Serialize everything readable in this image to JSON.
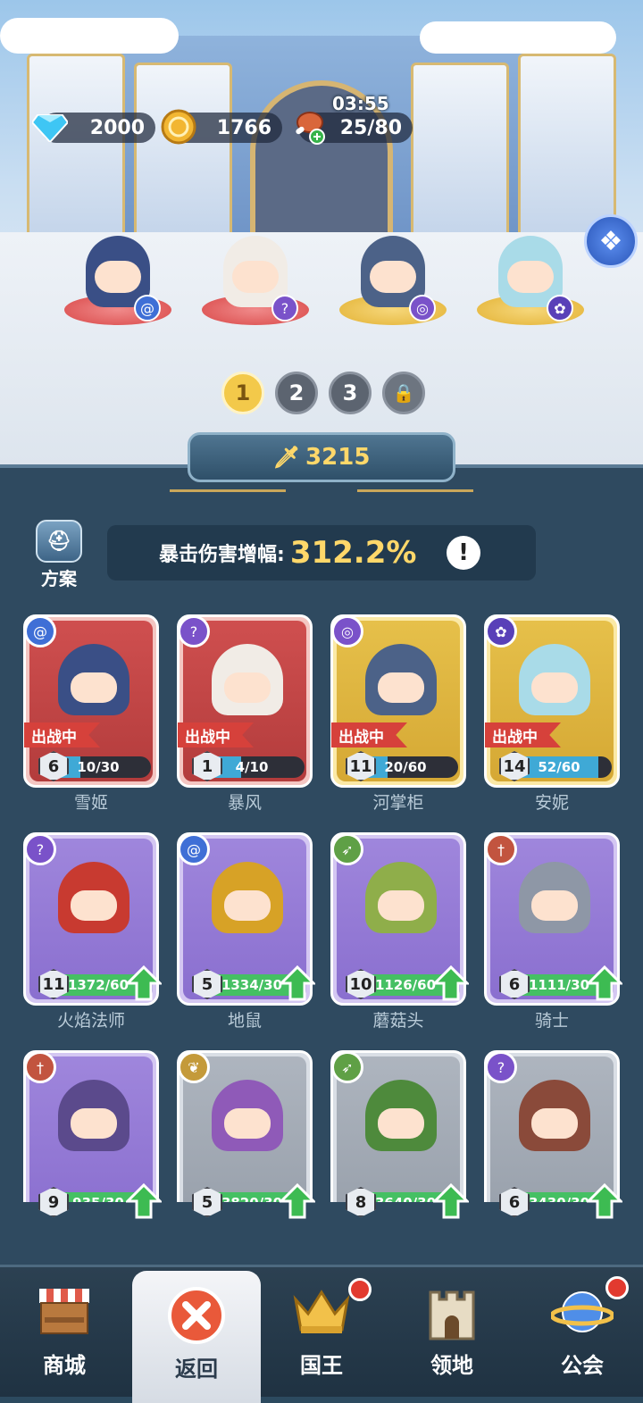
{
  "resources": {
    "gems": "2000",
    "gold": "1766",
    "stamina": "25/80",
    "stamina_timer": "03:55"
  },
  "heroes_on_field": [
    {
      "name": "雪姬",
      "ring": "red",
      "class_icon": "spiral-icon"
    },
    {
      "name": "暴风",
      "ring": "red",
      "class_icon": "wand-icon"
    },
    {
      "name": "河掌柜",
      "ring": "gold",
      "class_icon": "eye-icon"
    },
    {
      "name": "安妮",
      "ring": "gold",
      "class_icon": "paw-icon"
    }
  ],
  "teams": [
    "1",
    "2",
    "3"
  ],
  "power": "3215",
  "plan_label": "方案",
  "crit": {
    "label": "暴击伤害增幅:",
    "value": "312.2%",
    "info": "!"
  },
  "cards": [
    {
      "name": "雪姬",
      "rarity": "red",
      "class_icon": "spiral-icon",
      "status": "出战中",
      "level": "6",
      "progress": "10/30",
      "fill": 0.33,
      "upgrade": false,
      "color": "#3a4f86"
    },
    {
      "name": "暴风",
      "rarity": "red",
      "class_icon": "wand-icon",
      "status": "出战中",
      "level": "1",
      "progress": "4/10",
      "fill": 0.4,
      "upgrade": false,
      "color": "#f1ece6"
    },
    {
      "name": "河掌柜",
      "rarity": "gold",
      "class_icon": "eye-icon",
      "status": "出战中",
      "level": "11",
      "progress": "20/60",
      "fill": 0.33,
      "upgrade": false,
      "color": "#4c6288"
    },
    {
      "name": "安妮",
      "rarity": "gold",
      "class_icon": "paw-icon",
      "status": "出战中",
      "level": "14",
      "progress": "52/60",
      "fill": 0.87,
      "upgrade": false,
      "color": "#a9dbe8"
    },
    {
      "name": "火焰法师",
      "rarity": "purple",
      "class_icon": "wand-icon",
      "status": "",
      "level": "11",
      "progress": "1372/60",
      "fill": 1,
      "upgrade": true,
      "color": "#c83a30"
    },
    {
      "name": "地鼠",
      "rarity": "purple",
      "class_icon": "spiral-icon",
      "status": "",
      "level": "5",
      "progress": "1334/30",
      "fill": 1,
      "upgrade": true,
      "color": "#d7a226"
    },
    {
      "name": "蘑菇头",
      "rarity": "purple",
      "class_icon": "bow-icon",
      "status": "",
      "level": "10",
      "progress": "1126/60",
      "fill": 1,
      "upgrade": true,
      "color": "#8fae4a"
    },
    {
      "name": "骑士",
      "rarity": "purple",
      "class_icon": "sword-icon",
      "status": "",
      "level": "6",
      "progress": "1111/30",
      "fill": 1,
      "upgrade": true,
      "color": "#8e97a6"
    },
    {
      "name": "",
      "rarity": "purple",
      "class_icon": "sword-icon",
      "status": "",
      "level": "9",
      "progress": "935/30",
      "fill": 1,
      "upgrade": true,
      "color": "#5b4a8c"
    },
    {
      "name": "",
      "rarity": "gray",
      "class_icon": "laurel-icon",
      "status": "",
      "level": "5",
      "progress": "3820/30",
      "fill": 1,
      "upgrade": true,
      "color": "#8f5ab8"
    },
    {
      "name": "",
      "rarity": "gray",
      "class_icon": "bow-icon",
      "status": "",
      "level": "8",
      "progress": "3640/30",
      "fill": 1,
      "upgrade": true,
      "color": "#4e8a3c"
    },
    {
      "name": "",
      "rarity": "gray",
      "class_icon": "wand-icon",
      "status": "",
      "level": "6",
      "progress": "3430/30",
      "fill": 1,
      "upgrade": true,
      "color": "#8a4a3a"
    }
  ],
  "nav": [
    {
      "label": "商城",
      "icon": "shop-icon",
      "active": false,
      "dot": false
    },
    {
      "label": "返回",
      "icon": "close-icon",
      "active": true,
      "dot": false
    },
    {
      "label": "国王",
      "icon": "crown-icon",
      "active": false,
      "dot": true
    },
    {
      "label": "领地",
      "icon": "castle-icon",
      "active": false,
      "dot": false
    },
    {
      "label": "公会",
      "icon": "planet-icon",
      "active": false,
      "dot": true
    }
  ],
  "colors": {
    "class_purple": "#7a52c9",
    "class_blue": "#3f6fd6",
    "class_red": "#c2543f",
    "class_green": "#5fa046",
    "class_gold": "#c49a3a",
    "gold_text": "#ffd86a",
    "panel": "#2f4a60"
  }
}
